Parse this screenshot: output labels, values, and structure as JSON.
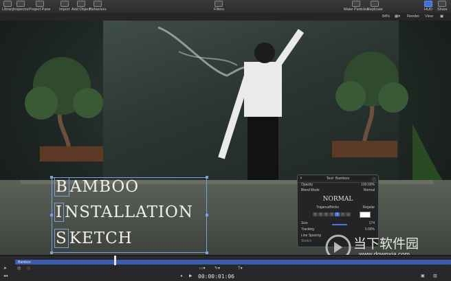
{
  "toolbar": {
    "library": "Library",
    "inspector": "Inspector",
    "project_pane": "Project Pane",
    "import": "Import",
    "add_object": "Add Object",
    "behaviors": "Behaviors",
    "filters": "Filters",
    "make_particles": "Make Particles",
    "replicate": "Replicate",
    "hud": "HUD",
    "share": "Share"
  },
  "viewbar": {
    "zoom": "84%",
    "render": "Render",
    "view": "View"
  },
  "title": {
    "line1_cap": "B",
    "line1_rest": "AMBOO",
    "line2_cap": "I",
    "line2_rest": "NSTALLATION",
    "line3_cap": "S",
    "line3_rest": "KETCH"
  },
  "hud": {
    "header": "Text: Bamboo",
    "opacity_label": "Opacity",
    "opacity_value": "100.00%",
    "blend_label": "Blend Mode",
    "blend_value": "Normal",
    "preset": "NORMAL",
    "font": "TrajanusBricks",
    "weight": "Regular",
    "size_label": "Size",
    "size_value": "174",
    "tracking_label": "Tracking",
    "tracking_value": "0.00%",
    "line_spacing_label": "Line Spacing",
    "more": "Sketch"
  },
  "timeline": {
    "clip_name": "Bamboo",
    "timecode": "00:00:01:06"
  },
  "watermark": {
    "name": "当下软件园",
    "url": "www.downxia.com"
  },
  "colors": {
    "accent": "#4d76d9",
    "selection": "#7ea0e0"
  }
}
